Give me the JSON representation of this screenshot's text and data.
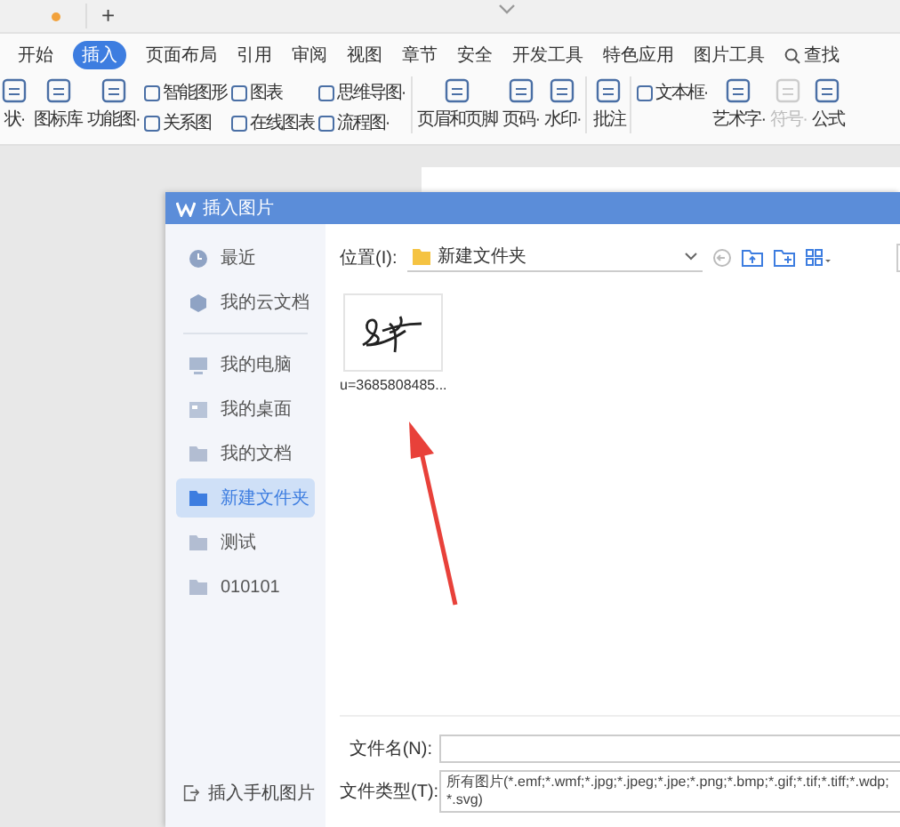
{
  "tab_strip": {
    "new_tab": "+"
  },
  "ribbon": {
    "tabs": [
      {
        "label": "开始",
        "selected": false,
        "kind": "tab"
      },
      {
        "label": "插入",
        "selected": true,
        "kind": "tab"
      },
      {
        "label": "页面布局",
        "selected": false,
        "kind": "tab"
      },
      {
        "label": "引用",
        "selected": false,
        "kind": "tab"
      },
      {
        "label": "审阅",
        "selected": false,
        "kind": "tab"
      },
      {
        "label": "视图",
        "selected": false,
        "kind": "tab"
      },
      {
        "label": "章节",
        "selected": false,
        "kind": "tab"
      },
      {
        "label": "安全",
        "selected": false,
        "kind": "tab"
      },
      {
        "label": "开发工具",
        "selected": false,
        "kind": "tab"
      },
      {
        "label": "特色应用",
        "selected": false,
        "kind": "tab"
      },
      {
        "label": "图片工具",
        "selected": false,
        "kind": "tab"
      },
      {
        "label": "查找",
        "selected": false,
        "kind": "search"
      }
    ],
    "tools": [
      {
        "kind": "large",
        "label": "状·",
        "disabled": false
      },
      {
        "kind": "large",
        "label": "图标库",
        "disabled": false
      },
      {
        "kind": "large",
        "label": "功能图·",
        "disabled": false
      },
      {
        "kind": "stack",
        "items": [
          {
            "label": "智能图形",
            "disabled": false
          },
          {
            "label": "关系图",
            "disabled": false
          }
        ]
      },
      {
        "kind": "stack",
        "items": [
          {
            "label": "图表",
            "disabled": false
          },
          {
            "label": "在线图表",
            "disabled": false
          }
        ]
      },
      {
        "kind": "stack",
        "items": [
          {
            "label": "思维导图·",
            "disabled": false
          },
          {
            "label": "流程图·",
            "disabled": false
          }
        ]
      },
      {
        "kind": "separator"
      },
      {
        "kind": "large",
        "label": "页眉和页脚",
        "disabled": false
      },
      {
        "kind": "large",
        "label": "页码·",
        "disabled": false
      },
      {
        "kind": "large",
        "label": "水印·",
        "disabled": false
      },
      {
        "kind": "separator"
      },
      {
        "kind": "large",
        "label": "批注",
        "disabled": false
      },
      {
        "kind": "separator"
      },
      {
        "kind": "stack",
        "items": [
          {
            "label": "文本框·",
            "disabled": false
          }
        ]
      },
      {
        "kind": "large",
        "label": "艺术字·",
        "disabled": false
      },
      {
        "kind": "large",
        "label": "符号·",
        "disabled": true
      },
      {
        "kind": "large",
        "label": "公式",
        "disabled": false
      }
    ]
  },
  "dialog": {
    "title": "插入图片",
    "sidebar": {
      "items": [
        {
          "label": "最近",
          "kind": "recent",
          "selected": false
        },
        {
          "label": "我的云文档",
          "kind": "cloud",
          "selected": false
        },
        {
          "kind": "divider"
        },
        {
          "label": "我的电脑",
          "kind": "computer",
          "selected": false
        },
        {
          "label": "我的桌面",
          "kind": "desktop",
          "selected": false
        },
        {
          "label": "我的文档",
          "kind": "folder",
          "selected": false
        },
        {
          "label": "新建文件夹",
          "kind": "folder",
          "selected": true
        },
        {
          "label": "测试",
          "kind": "folder",
          "selected": false
        },
        {
          "label": "010101",
          "kind": "folder",
          "selected": false
        }
      ],
      "mobile_button": "插入手机图片"
    },
    "location": {
      "label": "位置(I):",
      "folder": "新建文件夹"
    },
    "files": [
      {
        "name": "u=3685808485..."
      }
    ],
    "filename": {
      "label": "文件名(N):"
    },
    "filetype": {
      "label": "文件类型(T):",
      "value": "所有图片(*.emf;*.wmf;*.jpg;*.jpeg;*.jpe;*.png;*.bmp;*.gif;*.tif;*.tiff;*.wdp;*.svg)"
    }
  }
}
